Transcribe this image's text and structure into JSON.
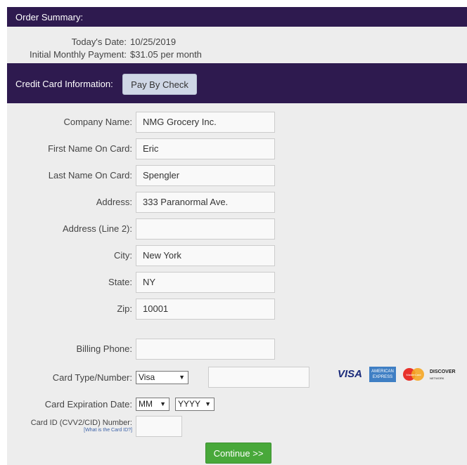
{
  "order_summary": {
    "header": "Order Summary:",
    "todays_date_label": "Today's Date:",
    "todays_date_value": "10/25/2019",
    "payment_label": "Initial Monthly Payment:",
    "payment_value": "$31.05 per month"
  },
  "credit_card": {
    "header": "Credit Card Information:",
    "pay_by_check": "Pay By Check"
  },
  "form": {
    "company_name": {
      "label": "Company Name:",
      "value": "NMG Grocery Inc."
    },
    "first_name": {
      "label": "First Name On Card:",
      "value": "Eric"
    },
    "last_name": {
      "label": "Last Name On Card:",
      "value": "Spengler"
    },
    "address": {
      "label": "Address:",
      "value": "333 Paranormal Ave."
    },
    "address2": {
      "label": "Address (Line 2):",
      "value": ""
    },
    "city": {
      "label": "City:",
      "value": "New York"
    },
    "state": {
      "label": "State:",
      "value": "NY"
    },
    "zip": {
      "label": "Zip:",
      "value": "10001"
    },
    "billing_phone": {
      "label": "Billing Phone:",
      "value": ""
    },
    "card_type_number": {
      "label": "Card Type/Number:",
      "card_type": "Visa",
      "card_number": ""
    },
    "expiration": {
      "label": "Card Expiration Date:",
      "month": "MM",
      "year": "YYYY"
    },
    "card_id": {
      "label": "Card ID (CVV2/CID) Number:",
      "help_link": "[What is the Card ID?]",
      "value": ""
    }
  },
  "cards": {
    "visa": "VISA",
    "amex_line1": "AMERICAN",
    "amex_line2": "EXPRESS",
    "mastercard": "MasterCard",
    "discover": "DISCOVER",
    "discover_sub": "NETWORK"
  },
  "continue_label": "Continue >>"
}
